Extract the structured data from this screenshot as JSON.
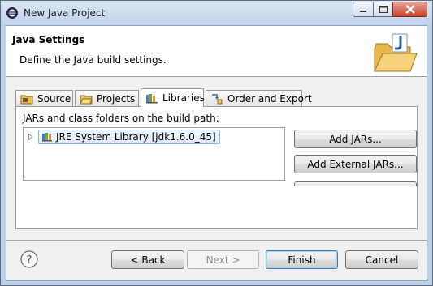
{
  "window": {
    "title": "New Java Project"
  },
  "header": {
    "title": "Java Settings",
    "description": "Define the Java build settings."
  },
  "tabs": [
    {
      "label": "Source",
      "icon": "source-folder-icon"
    },
    {
      "label": "Projects",
      "icon": "projects-folder-icon"
    },
    {
      "label": "Libraries",
      "icon": "libraries-icon",
      "selected": true
    },
    {
      "label": "Order and Export",
      "icon": "order-export-icon"
    }
  ],
  "libraries": {
    "label": "JARs and class folders on the build path:",
    "entries": [
      {
        "label": "JRE System Library [jdk1.6.0_45]",
        "icon": "jre-library-icon",
        "selected": true
      }
    ],
    "buttons": {
      "add_jars": "Add JARs...",
      "add_external_jars": "Add External JARs..."
    }
  },
  "footer": {
    "back": "< Back",
    "next": "Next >",
    "finish": "Finish",
    "cancel": "Cancel"
  },
  "colors": {
    "accent": "#3c7fb1",
    "selection": "#dde9f8"
  }
}
